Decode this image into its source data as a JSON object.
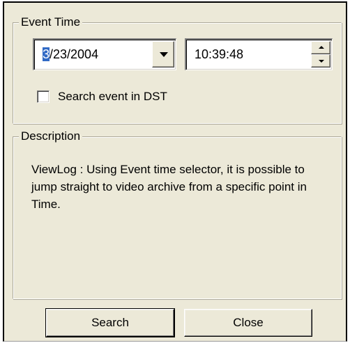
{
  "event_time": {
    "group_title": "Event Time",
    "date": {
      "selected_char": "3",
      "rest": "/23/2004"
    },
    "time": "10:39:48",
    "dst_checkbox": {
      "label": "Search event in DST",
      "checked": false
    }
  },
  "description": {
    "group_title": "Description",
    "text": "ViewLog : Using Event time selector, it is possible to jump straight to video archive from a specific point in Time."
  },
  "buttons": {
    "search": "Search",
    "close": "Close"
  },
  "icons": {
    "dropdown": "chevron-down-icon",
    "spin_up": "spin-up-icon",
    "spin_down": "spin-down-icon"
  },
  "colors": {
    "dialog_bg": "#ece9d8",
    "selection": "#316ac5"
  }
}
